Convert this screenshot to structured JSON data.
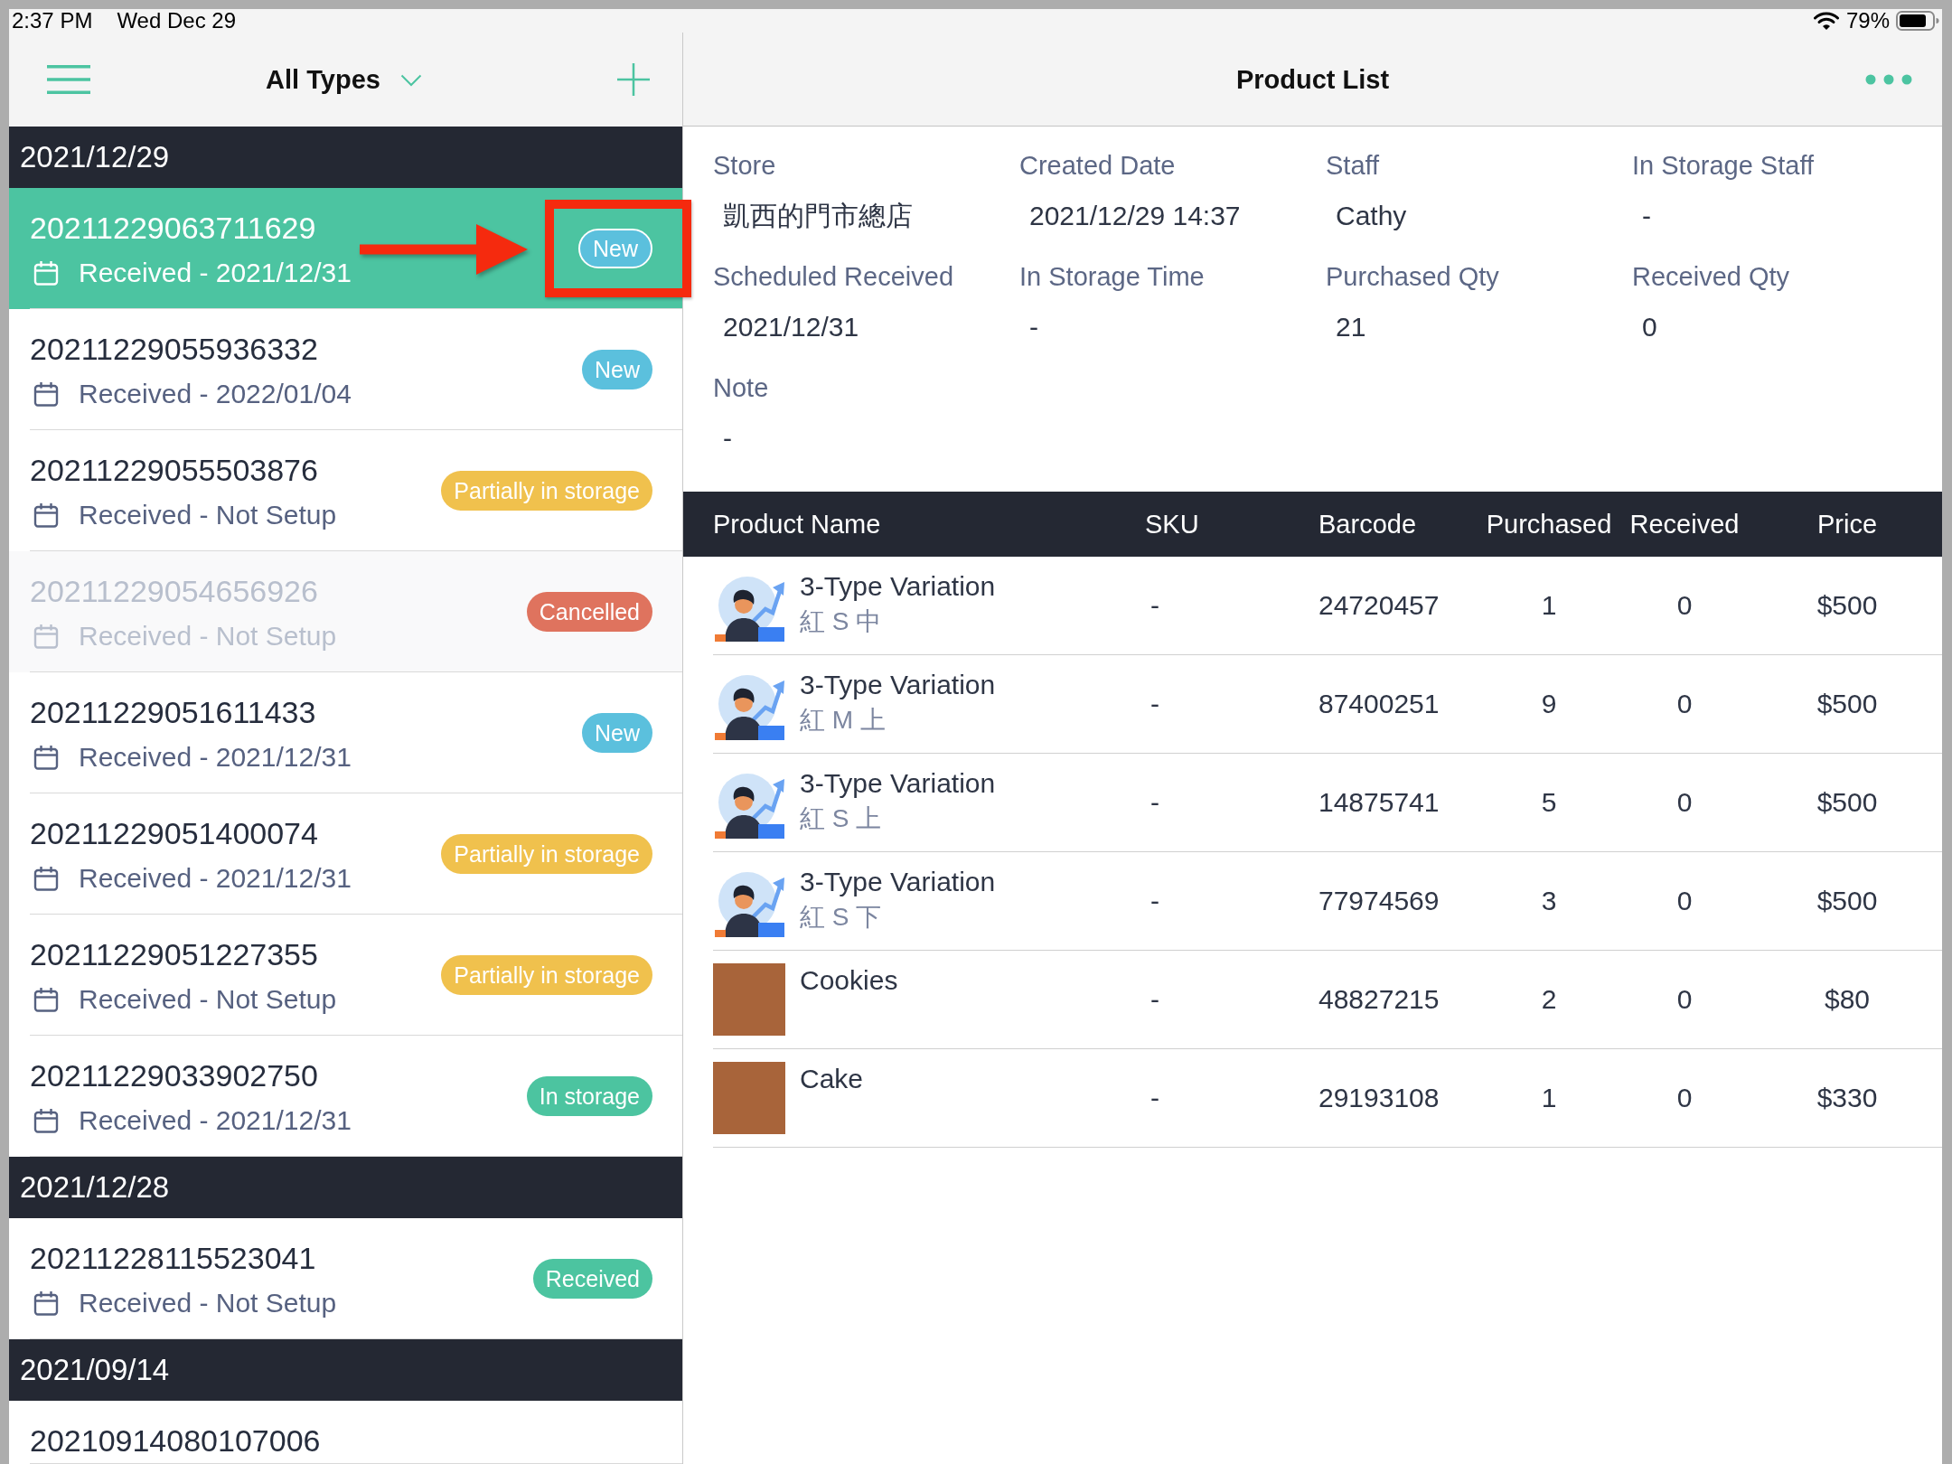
{
  "status_bar": {
    "time": "2:37 PM",
    "date": "Wed Dec 29",
    "battery": "79%"
  },
  "order_list": {
    "title": "All Types",
    "groups": [
      {
        "date": "2021/12/29",
        "orders": [
          {
            "number": "20211229063711629",
            "received": "Received - 2021/12/31",
            "status": {
              "label": "New",
              "color": "#5bc0dd"
            },
            "selected": true,
            "disabled": false,
            "callout": true
          },
          {
            "number": "20211229055936332",
            "received": "Received - 2022/01/04",
            "status": {
              "label": "New",
              "color": "#5bc0dd"
            },
            "selected": false,
            "disabled": false,
            "callout": false
          },
          {
            "number": "20211229055503876",
            "received": "Received - Not Setup",
            "status": {
              "label": "Partially in storage",
              "color": "#f0c14d"
            },
            "selected": false,
            "disabled": false,
            "callout": false
          },
          {
            "number": "20211229054656926",
            "received": "Received - Not Setup",
            "status": {
              "label": "Cancelled",
              "color": "#df735e"
            },
            "selected": false,
            "disabled": true,
            "callout": false
          },
          {
            "number": "20211229051611433",
            "received": "Received - 2021/12/31",
            "status": {
              "label": "New",
              "color": "#5bc0dd"
            },
            "selected": false,
            "disabled": false,
            "callout": false
          },
          {
            "number": "20211229051400074",
            "received": "Received - 2021/12/31",
            "status": {
              "label": "Partially in storage",
              "color": "#f0c14d"
            },
            "selected": false,
            "disabled": false,
            "callout": false
          },
          {
            "number": "20211229051227355",
            "received": "Received - Not Setup",
            "status": {
              "label": "Partially in storage",
              "color": "#f0c14d"
            },
            "selected": false,
            "disabled": false,
            "callout": false
          },
          {
            "number": "20211229033902750",
            "received": "Received - 2021/12/31",
            "status": {
              "label": "In storage",
              "color": "#4cc4a0"
            },
            "selected": false,
            "disabled": false,
            "callout": false
          }
        ]
      },
      {
        "date": "2021/12/28",
        "orders": [
          {
            "number": "20211228115523041",
            "received": "Received - Not Setup",
            "status": {
              "label": "Received",
              "color": "#4cc4a0"
            },
            "selected": false,
            "disabled": false,
            "callout": false
          }
        ]
      },
      {
        "date": "2021/09/14",
        "orders": [
          {
            "number": "20210914080107006",
            "selected": false,
            "disabled": false,
            "callout": false
          }
        ]
      }
    ]
  },
  "product_detail": {
    "title": "Product List",
    "fields": [
      {
        "label": "Store",
        "value": "凱西的門市總店"
      },
      {
        "label": "Created Date",
        "value": "2021/12/29 14:37"
      },
      {
        "label": "Staff",
        "value": "Cathy"
      },
      {
        "label": "In Storage Staff",
        "value": "-"
      },
      {
        "label": "Scheduled Received",
        "value": "2021/12/31"
      },
      {
        "label": "In Storage Time",
        "value": "-"
      },
      {
        "label": "Purchased Qty",
        "value": "21"
      },
      {
        "label": "Received Qty",
        "value": "0"
      },
      {
        "label": "Note",
        "value": "-"
      }
    ],
    "table": {
      "columns": [
        "Product Name",
        "SKU",
        "Barcode",
        "Purchased",
        "Received",
        "Price"
      ],
      "rows": [
        {
          "kind": "illustration",
          "name": "3-Type Variation",
          "variation": "紅 S 中",
          "sku": "-",
          "barcode": "24720457",
          "purchased": "1",
          "received": "0",
          "price": "$500"
        },
        {
          "kind": "illustration",
          "name": "3-Type Variation",
          "variation": "紅 M 上",
          "sku": "-",
          "barcode": "87400251",
          "purchased": "9",
          "received": "0",
          "price": "$500"
        },
        {
          "kind": "illustration",
          "name": "3-Type Variation",
          "variation": "紅 S 上",
          "sku": "-",
          "barcode": "14875741",
          "purchased": "5",
          "received": "0",
          "price": "$500"
        },
        {
          "kind": "illustration",
          "name": "3-Type Variation",
          "variation": "紅 S 下",
          "sku": "-",
          "barcode": "77974569",
          "purchased": "3",
          "received": "0",
          "price": "$500"
        },
        {
          "kind": "photo",
          "name": "Cookies",
          "sku": "-",
          "barcode": "48827215",
          "purchased": "2",
          "received": "0",
          "price": "$80"
        },
        {
          "kind": "photo",
          "name": "Cake",
          "sku": "-",
          "barcode": "29193108",
          "purchased": "1",
          "received": "0",
          "price": "$330"
        }
      ]
    }
  }
}
